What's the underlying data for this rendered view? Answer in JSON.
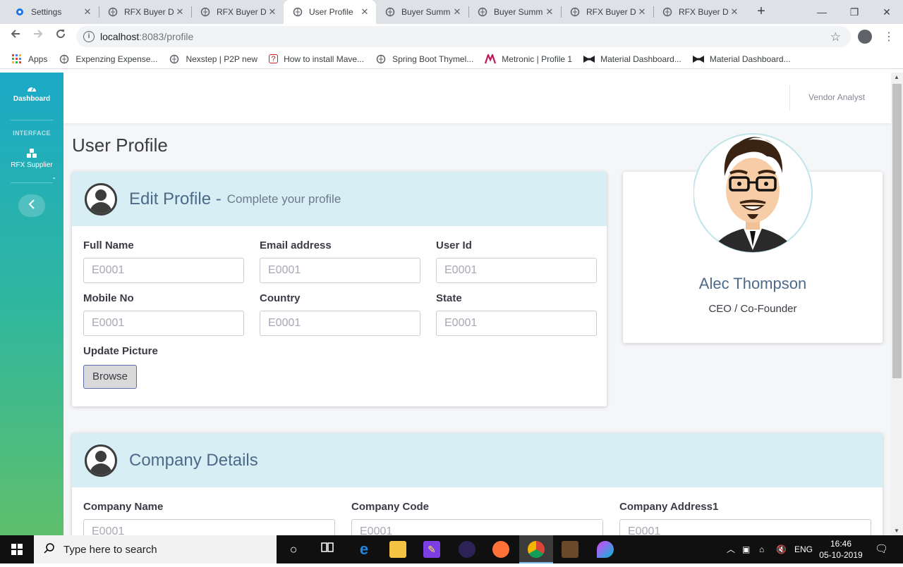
{
  "browser": {
    "tabs": [
      {
        "title": "Settings",
        "icon": "gear-icon",
        "active": false
      },
      {
        "title": "RFX Buyer D",
        "icon": "globe-icon",
        "active": false
      },
      {
        "title": "RFX Buyer D",
        "icon": "globe-icon",
        "active": false
      },
      {
        "title": "User Profile",
        "icon": "globe-icon",
        "active": true
      },
      {
        "title": "Buyer Summ",
        "icon": "globe-icon",
        "active": false
      },
      {
        "title": "Buyer Summ",
        "icon": "globe-icon",
        "active": false
      },
      {
        "title": "RFX Buyer D",
        "icon": "globe-icon",
        "active": false
      },
      {
        "title": "RFX Buyer D",
        "icon": "globe-icon",
        "active": false
      }
    ],
    "url_host": "localhost",
    "url_rest": ":8083/profile",
    "bookmarks": [
      {
        "label": "Apps",
        "icon": "apps-grid-icon"
      },
      {
        "label": "Expenzing Expense...",
        "icon": "globe-icon"
      },
      {
        "label": "Nexstep | P2P new",
        "icon": "globe-icon"
      },
      {
        "label": "How to install Mave...",
        "icon": "question-icon"
      },
      {
        "label": "Spring Boot Thymel...",
        "icon": "globe-icon"
      },
      {
        "label": "Metronic | Profile 1",
        "icon": "metronic-icon"
      },
      {
        "label": "Material Dashboard...",
        "icon": "bowtie-icon"
      },
      {
        "label": "Material Dashboard...",
        "icon": "bowtie-icon"
      }
    ]
  },
  "sidebar": {
    "dashboard_label": "Dashboard",
    "section_heading": "INTERFACE",
    "rfx_supplier_label": "RFX Supplier"
  },
  "topbar": {
    "role": "Vendor Analyst"
  },
  "page": {
    "title": "User Profile"
  },
  "edit_profile": {
    "title": "Edit Profile -",
    "subtitle": "Complete your profile",
    "fields": [
      {
        "label": "Full Name",
        "placeholder": "E0001"
      },
      {
        "label": "Email address",
        "placeholder": "E0001"
      },
      {
        "label": "User Id",
        "placeholder": "E0001"
      },
      {
        "label": "Mobile No",
        "placeholder": "E0001"
      },
      {
        "label": "Country",
        "placeholder": "E0001"
      },
      {
        "label": "State",
        "placeholder": "E0001"
      }
    ],
    "update_picture_label": "Update Picture",
    "browse_label": "Browse"
  },
  "profile_card": {
    "name": "Alec Thompson",
    "role": "CEO / Co-Founder"
  },
  "company": {
    "title": "Company Details",
    "fields": [
      {
        "label": "Company Name",
        "placeholder": "E0001"
      },
      {
        "label": "Company Code",
        "placeholder": "E0001"
      },
      {
        "label": "Company Address1",
        "placeholder": "E0001"
      }
    ]
  },
  "taskbar": {
    "search_placeholder": "Type here to search",
    "language": "ENG",
    "time": "16:46",
    "date": "05-10-2019"
  },
  "colors": {
    "sidebar_top": "#1ba9c7",
    "sidebar_bottom": "#5fbf6c",
    "card_header": "#d6eef4",
    "title_text": "#4e6a89"
  }
}
